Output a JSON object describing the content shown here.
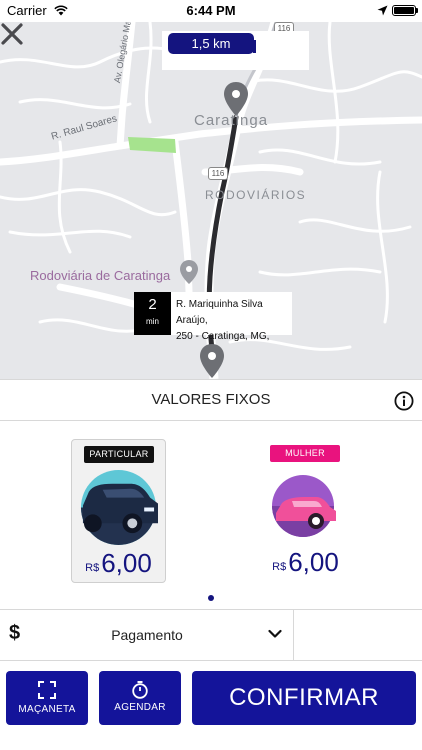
{
  "status_bar": {
    "carrier": "Carrier",
    "time": "6:44 PM"
  },
  "map": {
    "distance": "1,5 km",
    "labels": {
      "city": "Caratinga",
      "district": "RODOVIÁRIOS",
      "station": "Rodoviária de Caratinga",
      "street_raul": "R. Raul Soares",
      "street_olegario": "Av. Olegário Maciel",
      "route_shield_top": "116",
      "route_shield": "116"
    },
    "eta": {
      "minutes": "2",
      "unit": "min",
      "address_line1": "R. Mariquinha Silva Araújo,",
      "address_line2": "250 - Caratinga, MG,"
    }
  },
  "values": {
    "title": "VALORES FIXOS",
    "cards": [
      {
        "tag": "PARTICULAR",
        "currency": "R$",
        "price": "6,00",
        "selected": true
      },
      {
        "tag": "MULHER",
        "currency": "R$",
        "price": "6,00",
        "selected": false
      }
    ]
  },
  "payment": {
    "label": "Pagamento"
  },
  "actions": {
    "macaneta": "MAÇANETA",
    "agendar": "AGENDAR",
    "confirmar": "CONFIRMAR"
  },
  "colors": {
    "brand_navy": "#14147f",
    "button_blue": "#14149a",
    "pink": "#e9137e",
    "map_bg": "#e6e7ea"
  },
  "icons": {
    "close": "close-icon",
    "info": "info-icon",
    "dollar": "dollar-icon",
    "chevron": "chevron-down-icon",
    "macaneta": "expand-corners-icon",
    "agendar": "stopwatch-icon"
  }
}
